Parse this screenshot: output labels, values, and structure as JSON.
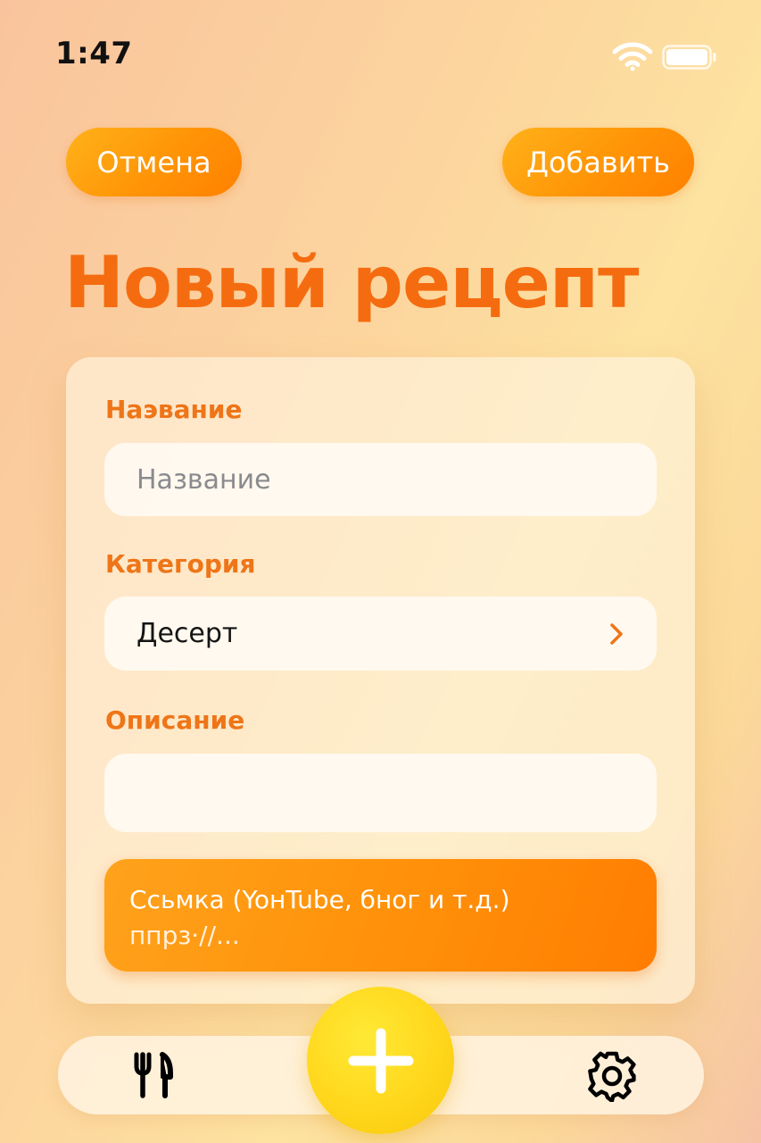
{
  "status_bar": {
    "time": "1:47",
    "wifi_icon": "wifi-icon",
    "battery_icon": "battery-icon"
  },
  "header": {
    "cancel_label": "Отмена",
    "add_label": "Добавить",
    "title": "Новый рецепт"
  },
  "form": {
    "name": {
      "label": "Наэвание",
      "placeholder": "Название",
      "value": ""
    },
    "category": {
      "label": "Категория",
      "value": "Десерт",
      "icon": "chevron-right-icon"
    },
    "description": {
      "label": "Описание",
      "value": ""
    },
    "link": {
      "label": "Ссьмка (YoнTube, бног и т.д.)",
      "placeholder": "ппрз·//..."
    }
  },
  "tab_bar": {
    "recipes_icon": "fork-knife-icon",
    "add_icon": "plus-icon",
    "settings_icon": "gear-icon"
  },
  "colors": {
    "accent": "#f56c10",
    "button_orange": "#ff9406",
    "fab_yellow": "#ffd71c"
  }
}
